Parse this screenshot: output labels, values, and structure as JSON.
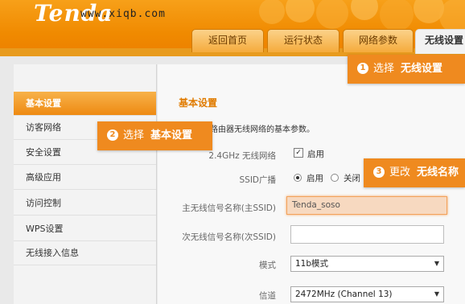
{
  "header": {
    "logo": "Tenda",
    "watermark": "www.xiqb.com",
    "tabs": [
      "返回首页",
      "运行状态",
      "网络参数",
      "无线设置"
    ]
  },
  "sidebar": {
    "items": [
      "基本设置",
      "访客网络",
      "安全设置",
      "高级应用",
      "访问控制",
      "WPS设置",
      "无线接入信息"
    ]
  },
  "main": {
    "title": "基本设置",
    "description": "置路由器无线网络的基本参数。",
    "wifi24": {
      "label": "2.4GHz 无线网络",
      "checked": true,
      "value": "启用"
    },
    "ssid_broadcast": {
      "label": "SSID广播",
      "options": [
        "启用",
        "关闭"
      ],
      "selected": "启用"
    },
    "primary_ssid": {
      "label": "主无线信号名称(主SSID)",
      "value": "Tenda_soso"
    },
    "secondary_ssid": {
      "label": "次无线信号名称(次SSID)",
      "value": ""
    },
    "mode": {
      "label": "模式",
      "value": "11b模式"
    },
    "channel": {
      "label": "信道",
      "value": "2472MHz (Channel 13)"
    }
  },
  "callouts": [
    {
      "num": "1",
      "action": "选择",
      "target": "无线设置"
    },
    {
      "num": "2",
      "action": "选择",
      "target": "基本设置"
    },
    {
      "num": "3",
      "action": "更改",
      "target": "无线名称"
    }
  ],
  "colors": {
    "accent": "#f08a00",
    "callout": "#ef8a1f",
    "title": "#e07b00"
  }
}
